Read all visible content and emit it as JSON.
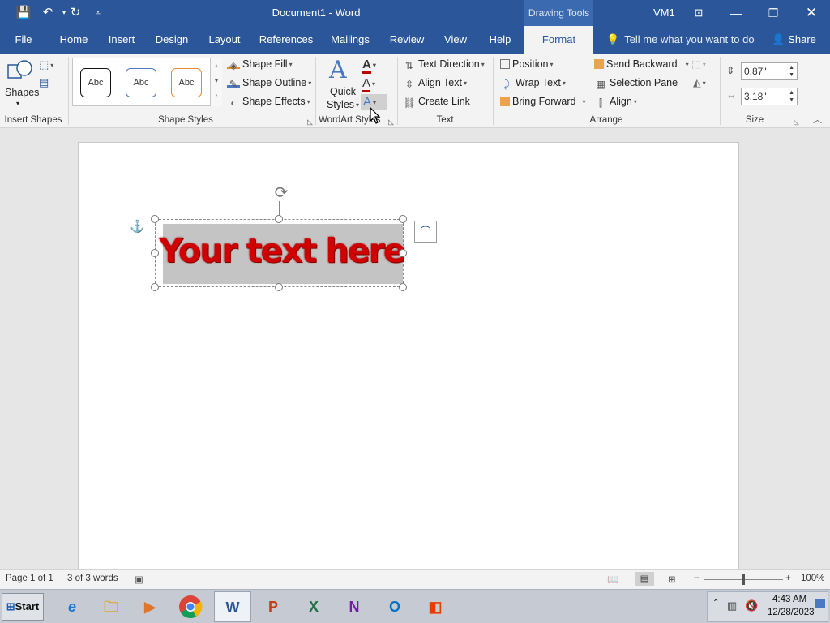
{
  "titlebar": {
    "doc_title": "Document1  -  Word",
    "context_tab": "Drawing Tools",
    "user": "VM1",
    "icons": [
      "save-icon",
      "undo-icon",
      "redo-icon",
      "customize-quick-access-icon"
    ],
    "window_buttons": [
      "ribbon-display-icon",
      "minimize-icon",
      "restore-icon",
      "close-icon"
    ]
  },
  "menu": {
    "tabs": [
      "File",
      "Home",
      "Insert",
      "Design",
      "Layout",
      "References",
      "Mailings",
      "Review",
      "View",
      "Help",
      "Format"
    ],
    "active_tab": "Format",
    "tell_me": "Tell me what you want to do",
    "share": "Share"
  },
  "ribbon": {
    "insert_shapes": {
      "shapes_label": "Shapes",
      "group": "Insert Shapes"
    },
    "shape_styles": {
      "gallery": [
        "Abc",
        "Abc",
        "Abc"
      ],
      "shape_fill": "Shape Fill",
      "shape_outline": "Shape Outline",
      "shape_effects": "Shape Effects",
      "group": "Shape Styles"
    },
    "wordart_styles": {
      "quick_styles_line1": "Quick",
      "quick_styles_line2": "Styles",
      "group": "WordArt Styles"
    },
    "text": {
      "text_direction": "Text Direction",
      "align_text": "Align Text",
      "create_link": "Create Link",
      "group": "Text"
    },
    "arrange": {
      "position": "Position",
      "wrap_text": "Wrap Text",
      "bring_forward": "Bring Forward",
      "send_backward": "Send Backward",
      "selection_pane": "Selection Pane",
      "align": "Align",
      "group": "Arrange"
    },
    "size": {
      "height": "0.87\"",
      "width": "3.18\"",
      "group": "Size"
    }
  },
  "document": {
    "wordart_text": "Your text here",
    "wordart_color": "#d00000"
  },
  "statusbar": {
    "page": "Page 1 of 1",
    "words": "3 of 3 words",
    "zoom": "100%",
    "zoom_level": 1.0
  },
  "taskbar": {
    "start": "Start",
    "apps": [
      "internet-explorer-icon",
      "file-explorer-icon",
      "media-player-icon",
      "chrome-icon",
      "word-icon",
      "powerpoint-icon",
      "excel-icon",
      "onenote-icon",
      "outlook-icon",
      "office-icon"
    ],
    "time": "4:43 AM",
    "date": "12/28/2023"
  }
}
